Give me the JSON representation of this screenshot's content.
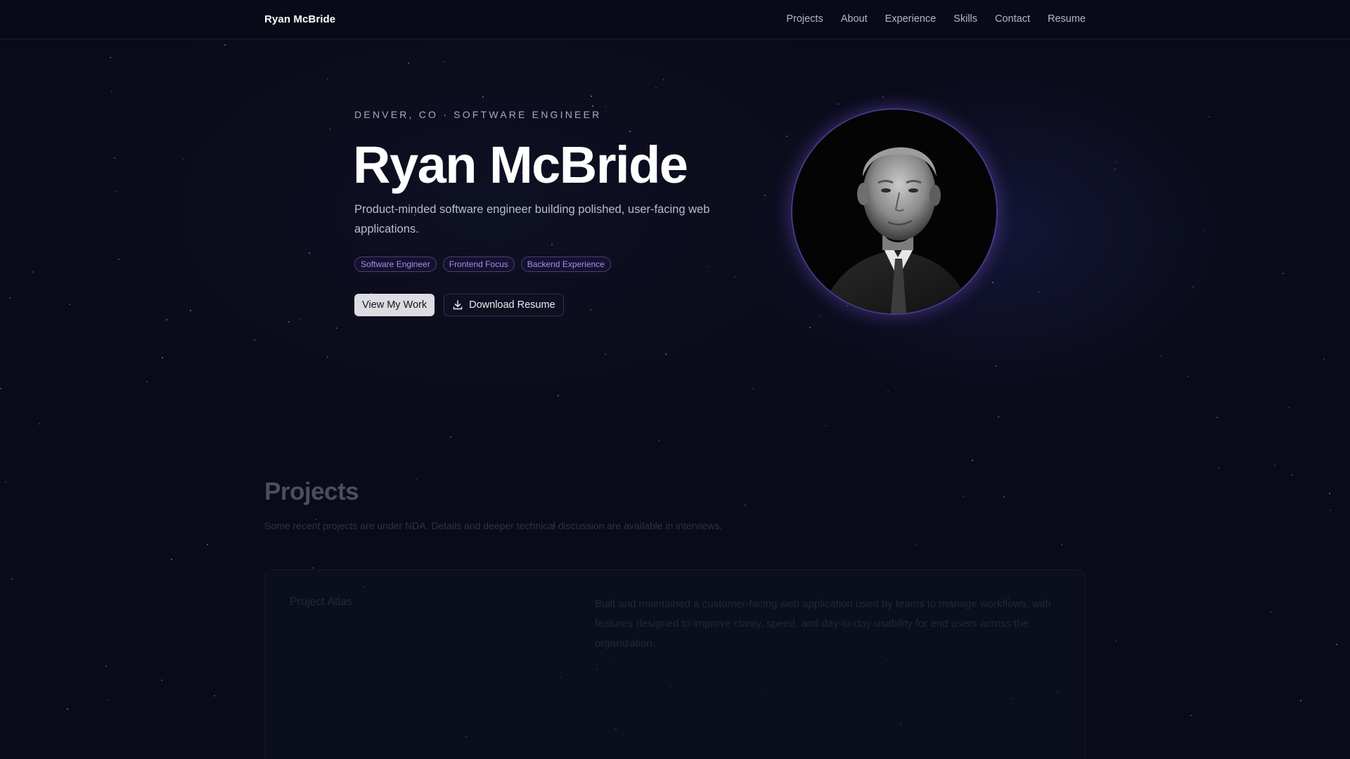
{
  "nav": {
    "brand": "Ryan McBride",
    "links": [
      "Projects",
      "About",
      "Experience",
      "Skills",
      "Contact",
      "Resume"
    ]
  },
  "hero": {
    "eyebrow": "DENVER, CO · SOFTWARE ENGINEER",
    "name": "Ryan McBride",
    "subtitle": "Product-minded software engineer building polished, user-facing web applications.",
    "tags": [
      "Software Engineer",
      "Frontend Focus",
      "Backend Experience"
    ],
    "primary_button": "View My Work",
    "secondary_button": "Download Resume",
    "secondary_button_icon": "download-icon"
  },
  "projects": {
    "title": "Projects",
    "note": "Some recent projects are under NDA. Details and deeper technical discussion are available in interviews.",
    "card": {
      "name": "Project Atlas",
      "description": "Built and maintained a customer-facing web application used by teams to manage workflows, with features designed to improve clarity, speed, and day-to-day usability for end users across the organization."
    }
  },
  "colors": {
    "background": "#090b18",
    "accent": "#a78bfa",
    "tag_border": "#4a3d7a"
  }
}
